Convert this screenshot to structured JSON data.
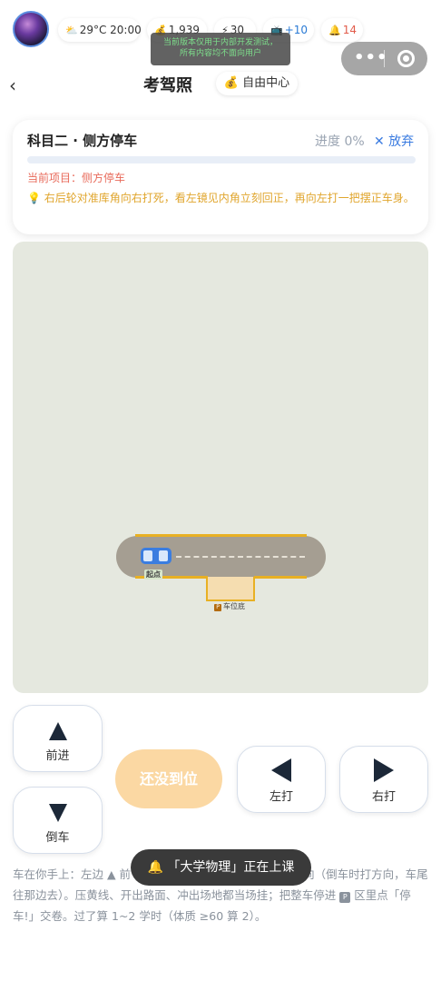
{
  "status": {
    "weather": "29°C 20:00",
    "coins": "1,939",
    "energy": "30",
    "tv": "+10",
    "alerts": "14"
  },
  "dev_notice": {
    "line1": "当前版本仅用于内部开发测试，",
    "line2": "所有内容均不面向用户"
  },
  "nav": {
    "back": "‹",
    "title": "考驾照",
    "free_center": "自由中心"
  },
  "task": {
    "title": "科目二 · 侧方停车",
    "progress_label": "进度 0%",
    "progress": 0,
    "quit": "✕ 放弃",
    "current": "当前项目：侧方停车",
    "hint": "右后轮对准库角向右打死，看左镜见内角立刻回正，再向左打一把摆正车身。"
  },
  "field": {
    "start_label": "起点",
    "bay_label": "车位底",
    "bay_icon": "P"
  },
  "controls": {
    "forward": "前进",
    "reverse": "倒车",
    "left": "左打",
    "right": "右打",
    "status": "还没到位"
  },
  "footnote": {
    "part1": "车在你手上：左边 ▲ 前",
    "part2": "向（倒车时打方向，车尾往那边去）。压黄线、开出路面、冲出场地都当场挂；把整车停进 ",
    "part3": " 区里点「停车!」交卷。过了算 1~2 学时（体质 ≥60 算 2）。"
  },
  "toast": "🔔 「大学物理」正在上课",
  "colors": {
    "accent": "#3a7be0",
    "warning": "#e0a52c",
    "danger": "#e86a5a",
    "line": "#e8b023"
  }
}
